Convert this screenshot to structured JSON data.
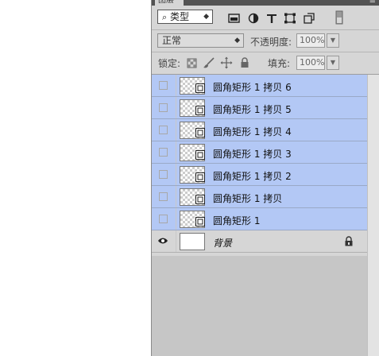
{
  "panel": {
    "tab_label": "图层",
    "menu_glyph": "≡"
  },
  "filter": {
    "kind_label": "类型",
    "kind_arrow": "◆"
  },
  "blend": {
    "mode": "正常",
    "opacity_label": "不透明度:",
    "opacity_value": "100%"
  },
  "lock": {
    "label": "锁定:",
    "fill_label": "填充:",
    "fill_value": "100%"
  },
  "layers": [
    {
      "name": "圆角矩形 1 拷贝 6",
      "visible": false,
      "selected": true
    },
    {
      "name": "圆角矩形 1 拷贝 5",
      "visible": false,
      "selected": true
    },
    {
      "name": "圆角矩形 1 拷贝 4",
      "visible": false,
      "selected": true
    },
    {
      "name": "圆角矩形 1 拷贝 3",
      "visible": false,
      "selected": true
    },
    {
      "name": "圆角矩形 1 拷贝 2",
      "visible": false,
      "selected": true
    },
    {
      "name": "圆角矩形 1 拷贝",
      "visible": false,
      "selected": true
    },
    {
      "name": "圆角矩形 1",
      "visible": false,
      "selected": true
    }
  ],
  "background_layer": {
    "name": "背景",
    "visible": true,
    "locked": true
  },
  "colors": {
    "selection": "#b3c8f5",
    "panel_bg": "#d6d6d6"
  }
}
